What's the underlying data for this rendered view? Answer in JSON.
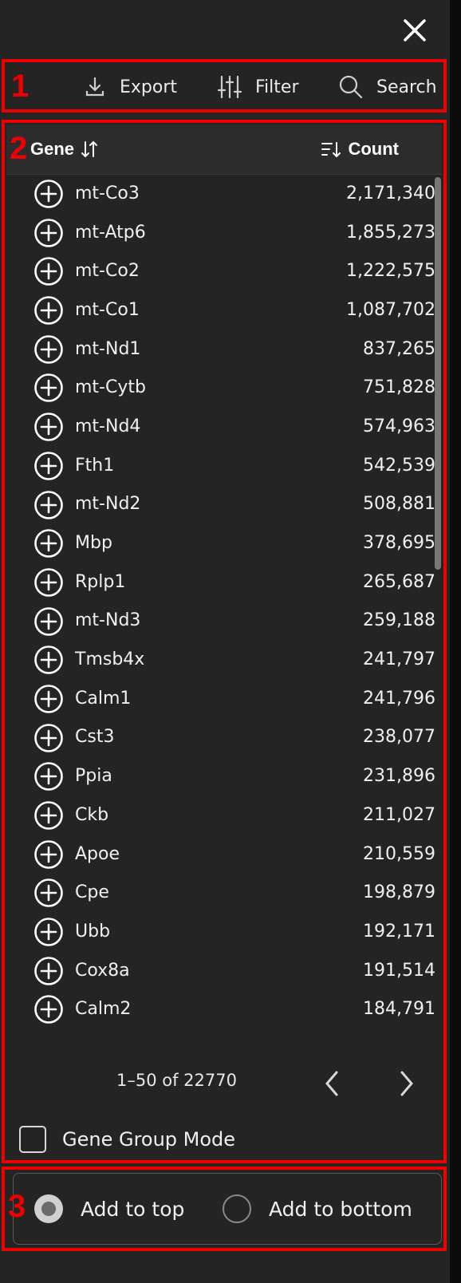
{
  "annotations": [
    "1",
    "2",
    "3"
  ],
  "toolbar": {
    "export_label": "Export",
    "filter_label": "Filter",
    "search_label": "Search"
  },
  "table": {
    "gene_header": "Gene",
    "count_header": "Count",
    "rows": [
      {
        "gene": "mt-Co3",
        "count": "2,171,340"
      },
      {
        "gene": "mt-Atp6",
        "count": "1,855,273"
      },
      {
        "gene": "mt-Co2",
        "count": "1,222,575"
      },
      {
        "gene": "mt-Co1",
        "count": "1,087,702"
      },
      {
        "gene": "mt-Nd1",
        "count": "837,265"
      },
      {
        "gene": "mt-Cytb",
        "count": "751,828"
      },
      {
        "gene": "mt-Nd4",
        "count": "574,963"
      },
      {
        "gene": "Fth1",
        "count": "542,539"
      },
      {
        "gene": "mt-Nd2",
        "count": "508,881"
      },
      {
        "gene": "Mbp",
        "count": "378,695"
      },
      {
        "gene": "Rplp1",
        "count": "265,687"
      },
      {
        "gene": "mt-Nd3",
        "count": "259,188"
      },
      {
        "gene": "Tmsb4x",
        "count": "241,797"
      },
      {
        "gene": "Calm1",
        "count": "241,796"
      },
      {
        "gene": "Cst3",
        "count": "238,077"
      },
      {
        "gene": "Ppia",
        "count": "231,896"
      },
      {
        "gene": "Ckb",
        "count": "211,027"
      },
      {
        "gene": "Apoe",
        "count": "210,559"
      },
      {
        "gene": "Cpe",
        "count": "198,879"
      },
      {
        "gene": "Ubb",
        "count": "192,171"
      },
      {
        "gene": "Cox8a",
        "count": "191,514"
      },
      {
        "gene": "Calm2",
        "count": "184,791"
      }
    ]
  },
  "pagination": {
    "label": "1–50 of 22770"
  },
  "gene_group_mode": {
    "label": "Gene Group Mode",
    "checked": false
  },
  "add_mode": {
    "options": [
      {
        "label": "Add to top",
        "selected": true
      },
      {
        "label": "Add to bottom",
        "selected": false
      }
    ]
  },
  "icons": {
    "close": "close-icon",
    "export": "download-icon",
    "filter": "sliders-icon",
    "search": "search-icon",
    "sort": "sort-arrows-icon",
    "sort_desc": "sort-desc-icon",
    "add": "plus-circle-icon",
    "prev": "chevron-left-icon",
    "next": "chevron-right-icon"
  },
  "colors": {
    "background": "#242424",
    "annotation": "#ee0000",
    "text": "#ffffff"
  }
}
